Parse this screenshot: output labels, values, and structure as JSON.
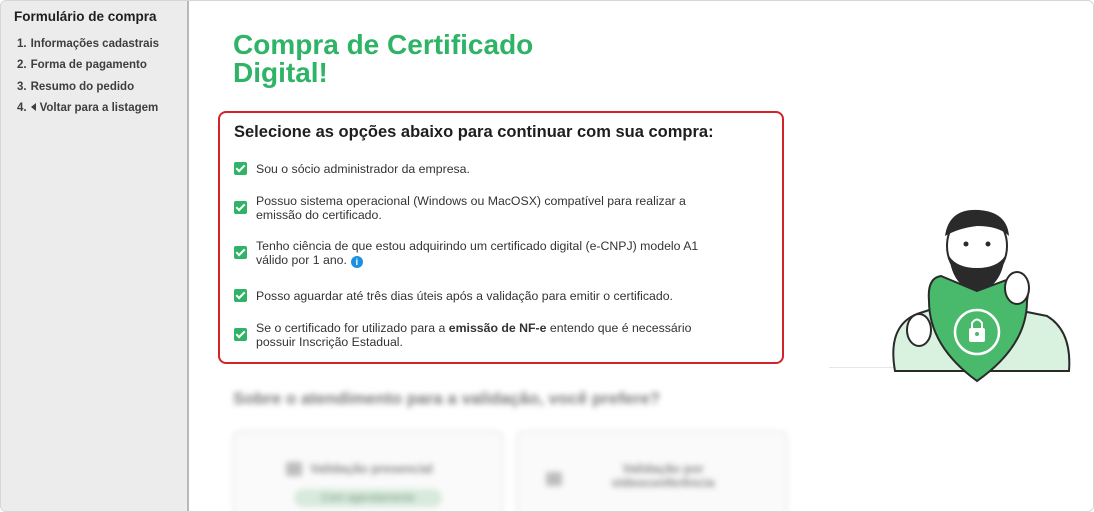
{
  "sidebar": {
    "title": "Formulário de compra",
    "items": [
      {
        "num": "1.",
        "label": "Informações cadastrais"
      },
      {
        "num": "2.",
        "label": "Forma de pagamento"
      },
      {
        "num": "3.",
        "label": "Resumo do pedido"
      },
      {
        "num": "4.",
        "label": "Voltar para a listagem"
      }
    ]
  },
  "main": {
    "title_line1": "Compra de Certificado",
    "title_line2": "Digital!",
    "box_heading": "Selecione as opções abaixo para continuar com sua compra:",
    "options": [
      {
        "text": "Sou o sócio administrador da empresa.",
        "checked": true
      },
      {
        "text": "Possuo sistema operacional (Windows ou MacOSX) compatível para realizar a emissão do certificado.",
        "checked": true
      },
      {
        "text": "Tenho ciência de que estou adquirindo um certificado digital (e-CNPJ) modelo A1 válido por 1 ano.",
        "checked": true
      },
      {
        "text": "Posso aguardar até três dias úteis após a validação para emitir o certificado.",
        "checked": true
      },
      {
        "text_before": "Se o certificado for utilizado para a ",
        "text_bold": "emissão de NF-e",
        "text_after": " entendo que é necessário possuir Inscrição Estadual.",
        "checked": true
      }
    ],
    "info_icon_glyph": "i",
    "validation_question": "Sobre o atendimento para a validação, você prefere?",
    "cards": [
      {
        "label": "Validação presencial",
        "pill": "Com agendamento",
        "icon": "building-icon"
      },
      {
        "label_line1": "Validação por",
        "label_line2": "videoconferência",
        "icon": "video-icon"
      }
    ]
  },
  "colors": {
    "brand_green": "#2fb366",
    "highlight_red": "#d2232a",
    "info_blue": "#1e90e0"
  }
}
